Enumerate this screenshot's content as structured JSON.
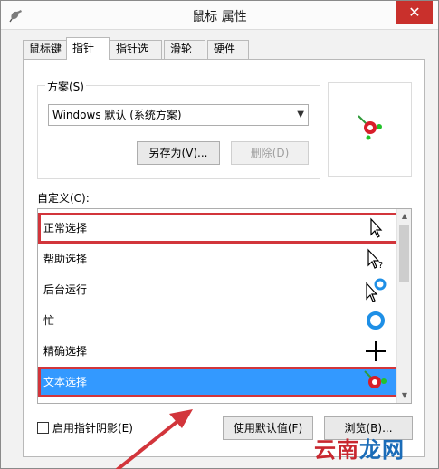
{
  "window": {
    "title": "鼠标 属性",
    "close_glyph": "✕"
  },
  "tabs": [
    {
      "label": "鼠标键",
      "active": false
    },
    {
      "label": "指针",
      "active": true
    },
    {
      "label": "指针选项",
      "active": false
    },
    {
      "label": "滑轮",
      "active": false
    },
    {
      "label": "硬件",
      "active": false
    }
  ],
  "scheme": {
    "group_label": "方案(S)",
    "selected": "Windows 默认 (系统方案)",
    "save_as_label": "另存为(V)...",
    "delete_label": "删除(D)"
  },
  "custom": {
    "label": "自定义(C):",
    "items": [
      {
        "label": "正常选择",
        "icon": "arrow-cursor-icon",
        "state": "boxed"
      },
      {
        "label": "帮助选择",
        "icon": "help-cursor-icon",
        "state": "normal"
      },
      {
        "label": "后台运行",
        "icon": "busy-background-cursor-icon",
        "state": "normal"
      },
      {
        "label": "忙",
        "icon": "busy-ring-cursor-icon",
        "state": "normal"
      },
      {
        "label": "精确选择",
        "icon": "crosshair-cursor-icon",
        "state": "normal"
      },
      {
        "label": "文本选择",
        "icon": "custom-text-cursor-icon",
        "state": "selected-boxed"
      }
    ]
  },
  "options": {
    "shadow_label": "启用指针阴影(E)",
    "shadow_checked": false,
    "use_default_label": "使用默认值(F)",
    "browse_label": "浏览(B)..."
  },
  "watermark": {
    "part1": "云",
    "part2": "南",
    "part3": "龙网"
  },
  "colors": {
    "highlight_red": "#d2353b",
    "selection_blue": "#3399ff",
    "ring_blue": "#1e8fe6"
  }
}
